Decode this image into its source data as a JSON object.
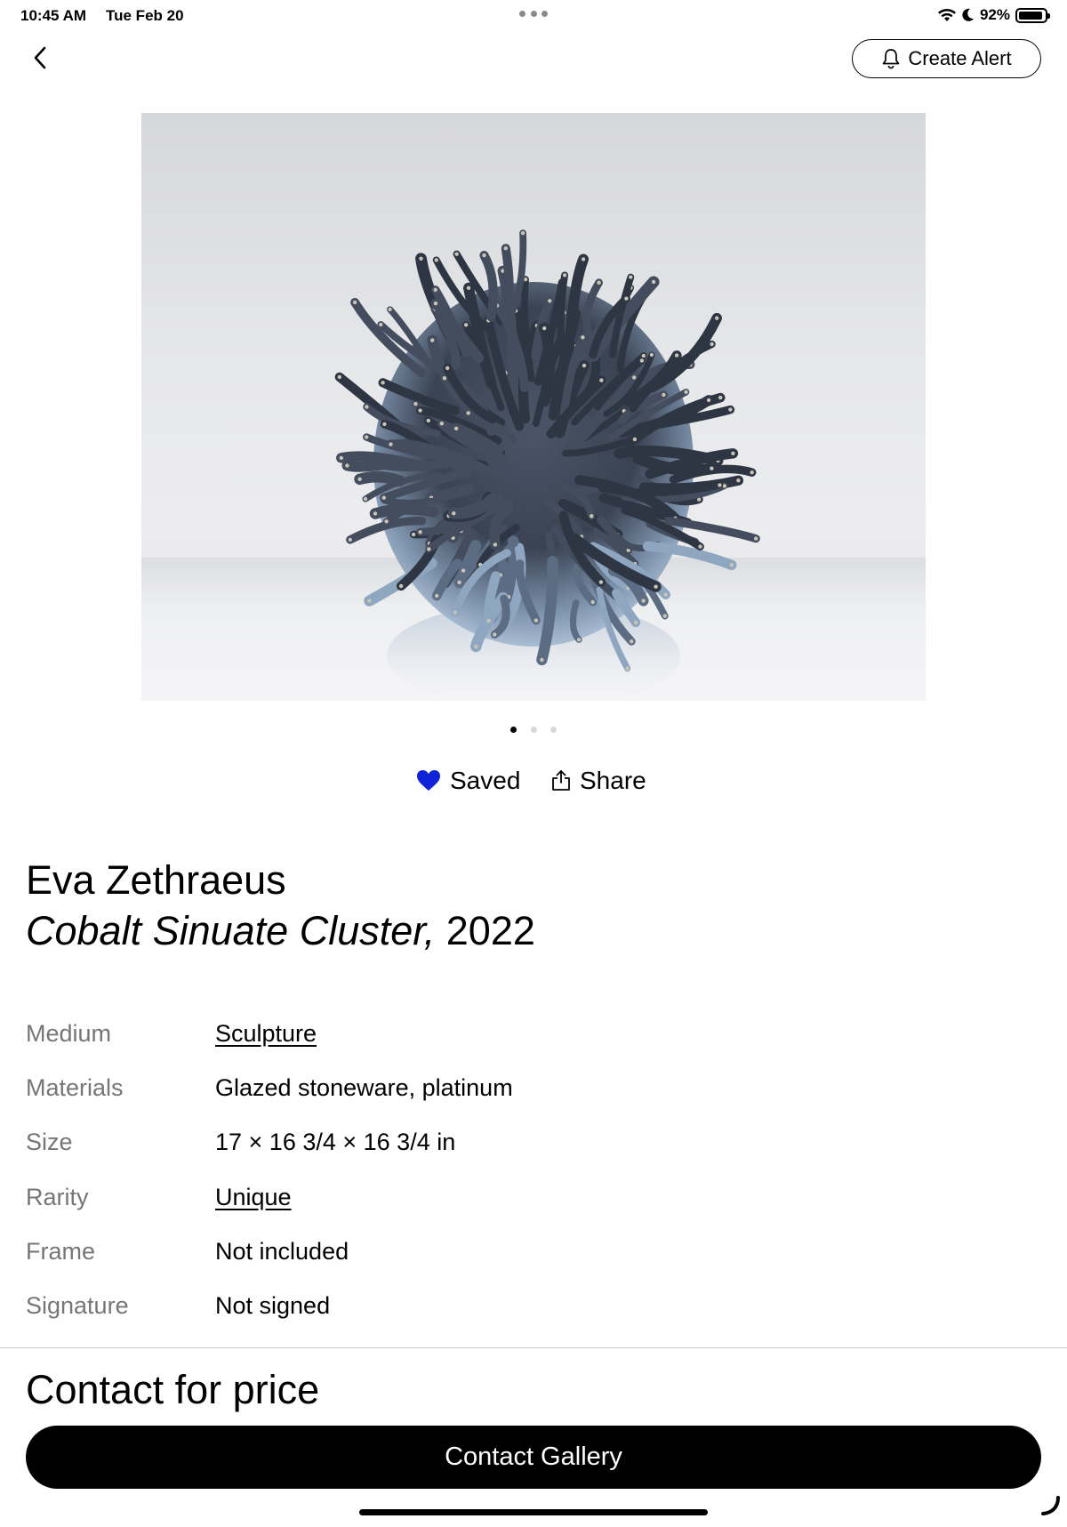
{
  "status_bar": {
    "time": "10:45 AM",
    "date": "Tue Feb 20",
    "battery": "92%",
    "battery_level": 0.92,
    "icons": [
      "wifi-icon",
      "moon-icon",
      "battery-icon"
    ]
  },
  "nav": {
    "back_icon": "chevron-left-icon",
    "create_alert_label": "Create Alert",
    "create_alert_icon": "bell-icon"
  },
  "carousel": {
    "count": 3,
    "active_index": 0
  },
  "actions": {
    "saved_label": "Saved",
    "saved_icon": "heart-icon",
    "saved_color": "#1023d7",
    "share_label": "Share",
    "share_icon": "share-icon"
  },
  "artwork": {
    "artist": "Eva Zethraeus",
    "title": "Cobalt Sinuate Cluster,",
    "year": "2022"
  },
  "details": [
    {
      "label": "Medium",
      "value": "Sculpture",
      "link": true
    },
    {
      "label": "Materials",
      "value": "Glazed stoneware, platinum",
      "link": false
    },
    {
      "label": "Size",
      "value": "17 × 16 3/4 × 16 3/4 in",
      "link": false
    },
    {
      "label": "Rarity",
      "value": "Unique",
      "link": true
    },
    {
      "label": "Frame",
      "value": "Not included",
      "link": false
    },
    {
      "label": "Signature",
      "value": "Not signed",
      "link": false
    }
  ],
  "price": "Contact for price",
  "cta_label": "Contact Gallery"
}
